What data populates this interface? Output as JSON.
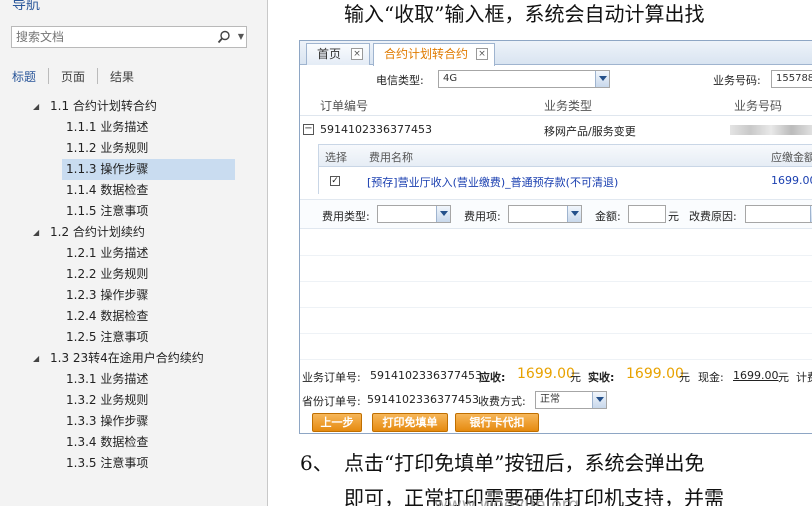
{
  "nav": {
    "title": "导航",
    "search_placeholder": "搜索文档",
    "tabs": [
      "标题",
      "页面",
      "结果"
    ],
    "outline": [
      {
        "level": 1,
        "label": "1.1 合约计划转合约"
      },
      {
        "level": 2,
        "label": "1.1.1 业务描述"
      },
      {
        "level": 2,
        "label": "1.1.2 业务规则"
      },
      {
        "level": 2,
        "label": "1.1.3 操作步骤",
        "selected": true
      },
      {
        "level": 2,
        "label": "1.1.4 数据检查"
      },
      {
        "level": 2,
        "label": "1.1.5 注意事项"
      },
      {
        "level": 1,
        "label": "1.2 合约计划续约"
      },
      {
        "level": 2,
        "label": "1.2.1 业务描述"
      },
      {
        "level": 2,
        "label": "1.2.2 业务规则"
      },
      {
        "level": 2,
        "label": "1.2.3 操作步骤"
      },
      {
        "level": 2,
        "label": "1.2.4 数据检查"
      },
      {
        "level": 2,
        "label": "1.2.5 注意事项"
      },
      {
        "level": 1,
        "label": "1.3 23转4在途用户合约续约"
      },
      {
        "level": 2,
        "label": "1.3.1 业务描述"
      },
      {
        "level": 2,
        "label": "1.3.2 业务规则"
      },
      {
        "level": 2,
        "label": "1.3.3 操作步骤"
      },
      {
        "level": 2,
        "label": "1.3.4 数据检查"
      },
      {
        "level": 2,
        "label": "1.3.5 注意事项"
      }
    ]
  },
  "doc": {
    "line_top": "输入“收取”输入框，系统会自动计算出找",
    "step6_num": "6、",
    "step6_text": "点击“打印免填单”按钮后，系统会弹出免",
    "step6_cont": "即可，正常打印需要硬件打印机支持，并需"
  },
  "app": {
    "tabs": [
      {
        "label": "首页",
        "close": "×"
      },
      {
        "label": "合约计划转合约",
        "close": "×"
      }
    ],
    "telecom_type_label": "电信类型:",
    "telecom_type_value": "4G",
    "biz_no_label": "业务号码:",
    "biz_no_value": "155788",
    "grid_headers": [
      "订单编号",
      "业务类型",
      "业务号码"
    ],
    "order": {
      "expander": "−",
      "order_no": "5914102336377453",
      "biz_type": "移网产品/服务变更"
    },
    "fee_grid": {
      "headers": [
        "选择",
        "费用名称",
        "应缴金额"
      ],
      "row": {
        "check": "✓",
        "name": "[预存]营业厅收入(营业缴费)_普通预存款(不可清退)",
        "amount": "1699.00"
      }
    },
    "filters": {
      "fee_type_label": "费用类型:",
      "fee_item_label": "费用项:",
      "amount_label": "金额:",
      "yuan": "元",
      "reason_label": "改费原因:"
    },
    "summary": {
      "biz_order_label": "业务订单号:",
      "biz_order_no": "5914102336377453",
      "receivable_label": "应收:",
      "receivable": "1699.00",
      "yuan1": "元",
      "received_label": "实收:",
      "received": "1699.00",
      "yuan2": "元",
      "cash_label": "现金:",
      "cash": "1699.00",
      "yuan3": "元",
      "extra": "计费",
      "prov_order_label": "省份订单号:",
      "prov_order_no": "5914102336377453",
      "charge_mode_label": "收费方式:",
      "charge_mode": "正常"
    },
    "buttons": {
      "prev": "上一步",
      "print": "打印免填单",
      "bank": "银行卡代扣"
    }
  },
  "watermark": "www.wooyun.org"
}
